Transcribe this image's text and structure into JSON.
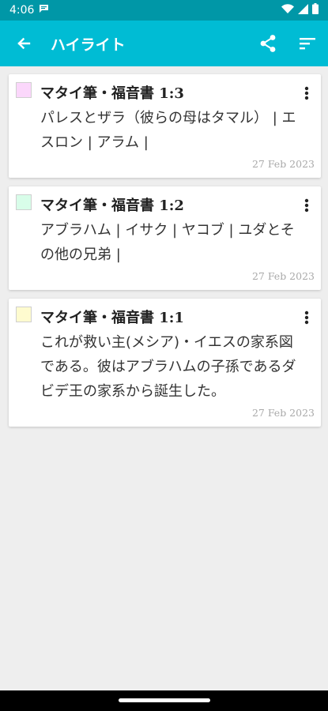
{
  "status_bar": {
    "time": "4:06"
  },
  "app_bar": {
    "title": "ハイライト"
  },
  "highlights": [
    {
      "title": "マタイ筆・福音書 1:3",
      "body": "パレスとザラ（彼らの母はタマル） | エスロン | アラム |",
      "date": "27 Feb 2023",
      "color": "#fbd7fb"
    },
    {
      "title": "マタイ筆・福音書 1:2",
      "body": "アブラハム | イサク | ヤコブ | ユダとその他の兄弟 |",
      "date": "27 Feb 2023",
      "color": "#d8fde9"
    },
    {
      "title": "マタイ筆・福音書 1:1",
      "body": "これが救い主(メシア)・イエスの家系図である。彼はアブラハムの子孫であるダビデ王の家系から誕生した。",
      "date": "27 Feb 2023",
      "color": "#fefbcf"
    }
  ],
  "colors": {
    "status_bar": "#0097a7",
    "app_bar": "#00bcd4",
    "background": "#eeeeee"
  }
}
